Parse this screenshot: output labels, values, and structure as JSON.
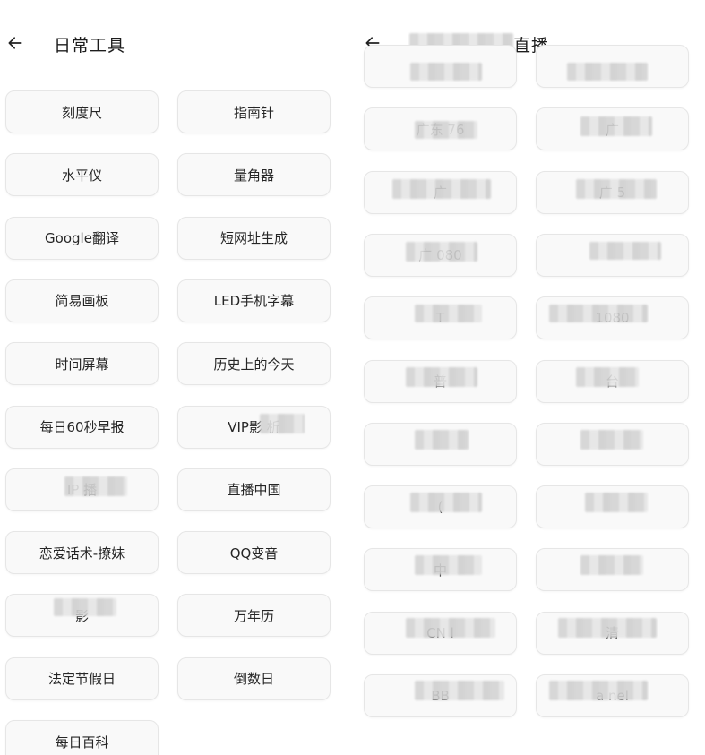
{
  "left": {
    "title": "日常工具",
    "buttons": [
      "刻度尺",
      "指南针",
      "水平仪",
      "量角器",
      "Google翻译",
      "短网址生成",
      "简易画板",
      "LED手机字幕",
      "时间屏幕",
      "历史上的今天",
      "每日60秒早报",
      "VIP影 析",
      "IP 播",
      "直播中国",
      "恋爱话术-撩妹",
      "QQ变音",
      "影 ",
      "万年历",
      "法定节假日",
      "倒数日",
      "每日百科"
    ]
  },
  "right": {
    "title": "直播",
    "buttons": [
      "",
      "",
      "广东 76",
      "广 ",
      "广 ",
      "广 5",
      "广 080",
      "",
      "T ",
      " 1080",
      "普 ",
      " 台",
      "",
      "",
      "( ",
      "",
      "中 ",
      "",
      "CN l",
      " 清",
      "BB ",
      " a nel"
    ]
  },
  "icons": {
    "back": "arrow-left-icon"
  }
}
